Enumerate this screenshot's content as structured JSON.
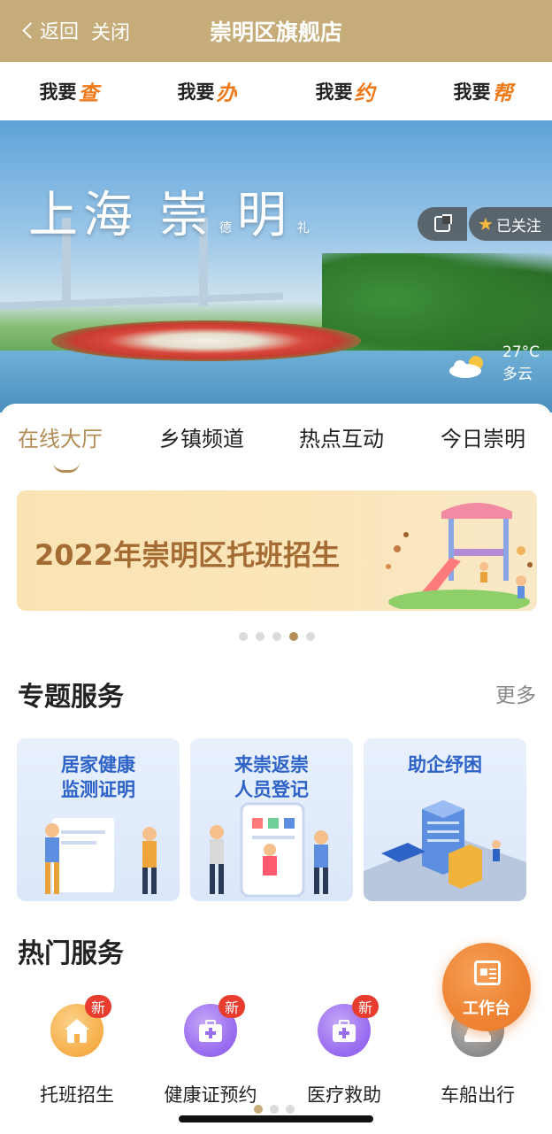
{
  "header": {
    "back_label": "返回",
    "close_label": "关闭",
    "title": "崇明区旗舰店",
    "color": "#c5ac78"
  },
  "quick_tabs": [
    {
      "prefix": "我要",
      "accent": "查"
    },
    {
      "prefix": "我要",
      "accent": "办"
    },
    {
      "prefix": "我要",
      "accent": "约"
    },
    {
      "prefix": "我要",
      "accent": "帮"
    }
  ],
  "banner": {
    "sign_part1": "上海",
    "sign_part2": "崇",
    "sign_small1": "德",
    "sign_part3": "明",
    "sign_small2": "礼",
    "follow_label": "已关注",
    "weather": {
      "temp": "27°C",
      "condition": "多云"
    }
  },
  "content_tabs": [
    {
      "label": "在线大厅",
      "active": true
    },
    {
      "label": "乡镇频道",
      "active": false
    },
    {
      "label": "热点互动",
      "active": false
    },
    {
      "label": "今日崇明",
      "active": false
    }
  ],
  "promo": {
    "text": "2022年崇明区托班招生",
    "carousel_count": 5,
    "carousel_active": 4
  },
  "special_services": {
    "title": "专题服务",
    "more_label": "更多",
    "cards": [
      {
        "line1": "居家健康",
        "line2": "监测证明"
      },
      {
        "line1": "来崇返崇",
        "line2": "人员登记"
      },
      {
        "line1": "助企纾困",
        "line2": ""
      }
    ]
  },
  "hot_services": {
    "title": "热门服务",
    "items": [
      {
        "label": "托班招生",
        "badge": "新",
        "icon": "building-icon",
        "color": "#f6b04d"
      },
      {
        "label": "健康证预约",
        "badge": "新",
        "icon": "medical-kit-icon",
        "color": "#9a6cf0"
      },
      {
        "label": "医疗救助",
        "badge": "新",
        "icon": "medical-kit-icon",
        "color": "#9a6cf0"
      },
      {
        "label": "车船出行",
        "badge": "",
        "icon": "car-icon",
        "color": "#8c8c8c"
      }
    ],
    "page_count": 3,
    "page_active": 1
  },
  "workbench": {
    "label": "工作台"
  }
}
